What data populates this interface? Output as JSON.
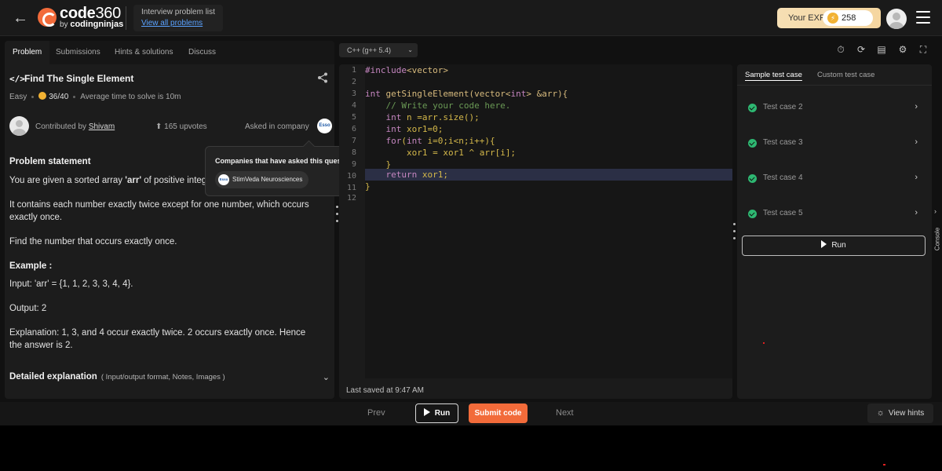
{
  "header": {
    "logo_text": "code",
    "logo_num": "360",
    "logo_sub_prefix": "by",
    "logo_sub_brand": "codingninjas",
    "list_title": "Interview problem list",
    "list_link": "View all problems",
    "exp_label": "Your EXP",
    "exp_value": "258"
  },
  "tabs": [
    "Problem",
    "Submissions",
    "Hints & solutions",
    "Discuss"
  ],
  "problem": {
    "title": "Find The Single Element",
    "difficulty": "Easy",
    "score": "36/40",
    "avg_time": "Average time to solve is 10m",
    "contributed_by": "Contributed by",
    "author": "Shivam",
    "upvotes": "165 upvotes",
    "asked_in": "Asked in company",
    "company_logo": "Esso",
    "statement_heading": "Problem statement",
    "statement_line1_pre": "You are given a sorted array ",
    "statement_line1_bold": "'arr'",
    "statement_line1_post": " of positive integ",
    "para2": "It contains each number exactly twice except for one number, which occurs exactly once.",
    "para3": "Find the number that occurs exactly once.",
    "example_heading": "Example :",
    "input": "Input: 'arr' = {1, 1, 2, 3, 3, 4, 4}.",
    "output": "Output: 2",
    "explanation": "Explanation: 1, 3, and 4 occur exactly twice. 2 occurs exactly once. Hence the answer is 2.",
    "detail_title": "Detailed explanation",
    "detail_sub": "( Input/output format, Notes, Images )"
  },
  "popover": {
    "title": "Companies that have asked this question",
    "company": "StimVeda Neurosciences",
    "company_logo": "Esso"
  },
  "editor": {
    "language": "C++ (g++ 5.4)",
    "line_numbers": [
      "1",
      "2",
      "3",
      "4",
      "5",
      "6",
      "7",
      "8",
      "9",
      "10",
      "11",
      "12"
    ],
    "last_saved": "Last saved at 9:47 AM"
  },
  "tests": {
    "tab_sample": "Sample test case",
    "tab_custom": "Custom test case",
    "cases": [
      "Test case 2",
      "Test case 3",
      "Test case 4",
      "Test case 5"
    ],
    "run_label": "Run",
    "console_label": "Console"
  },
  "footer": {
    "prev": "Prev",
    "run": "Run",
    "submit": "Submit code",
    "next": "Next",
    "hints": "View hints"
  },
  "colors": {
    "accent": "#f26b3a",
    "success": "#2eb872",
    "link": "#5aa2ff",
    "exp_bg": "#f5d6a0"
  }
}
